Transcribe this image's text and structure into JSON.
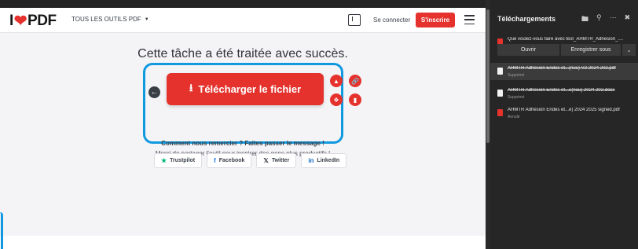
{
  "site": {
    "logo_text_left": "I",
    "logo_text_right": "PDF",
    "tools_menu": "TOUS LES OUTILS PDF",
    "login": "Se connecter",
    "signup": "S'inscrire"
  },
  "main": {
    "headline": "Cette tâche a été traitée avec succès.",
    "download_button": "Télécharger le fichier",
    "thanks": "Comment nous remercier ? Faites passer le message !",
    "share": "Merci de partager l'outil pour inspirer des gens plus productifs !",
    "socials": [
      "Trustpilot",
      "Facebook",
      "Twitter",
      "LinkedIn"
    ]
  },
  "downloads": {
    "title": "Téléchargements",
    "prompt": "Que voulez-vous faire avec test_AHMTR_Adhesion_....",
    "open_button": "Ouvrir",
    "save_button": "Enregistrer sous",
    "items": [
      {
        "name": "AHMTR Adhesion Endes et...(nuu) V2 2024 202.pdf",
        "status": "Supprimé"
      },
      {
        "name": "AHMTR Adhesion Endes et...u(nuu) 2024 202.docx",
        "status": "Supprimé"
      },
      {
        "name": "AHMTR Adhesion Endes et...e) 2024 2025 signed.pdf",
        "status": "Annulé"
      }
    ]
  },
  "colors": {
    "accent_red": "#e5322d",
    "focus_blue": "#1199e0",
    "panel_bg": "#262626"
  }
}
